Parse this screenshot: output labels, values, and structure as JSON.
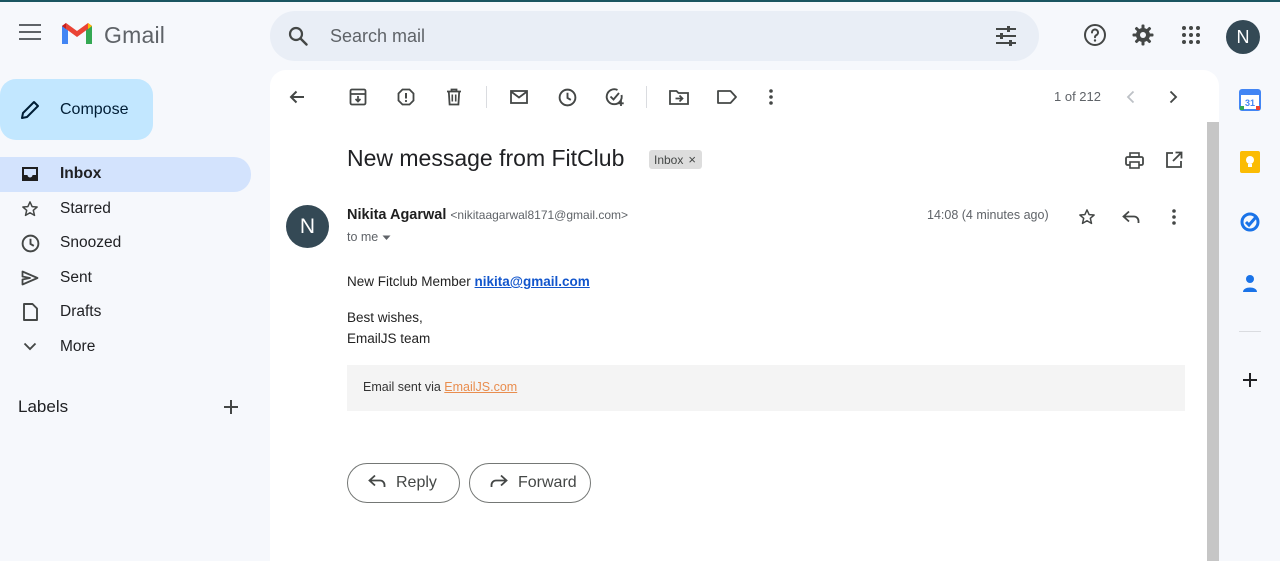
{
  "app": {
    "name": "Gmail"
  },
  "search": {
    "placeholder": "Search mail"
  },
  "header": {
    "account_initial": "N"
  },
  "nav": {
    "compose_label": "Compose",
    "items": [
      {
        "label": "Inbox",
        "icon": "inbox-icon",
        "active": true
      },
      {
        "label": "Starred",
        "icon": "star-icon"
      },
      {
        "label": "Snoozed",
        "icon": "clock-icon"
      },
      {
        "label": "Sent",
        "icon": "send-icon"
      },
      {
        "label": "Drafts",
        "icon": "draft-icon"
      },
      {
        "label": "More",
        "icon": "chevron-down-icon"
      }
    ],
    "labels_title": "Labels"
  },
  "message": {
    "pager": "1 of 212",
    "subject": "New message from FitClub",
    "badge": "Inbox",
    "sender_initial": "N",
    "sender_name": "Nikita Agarwal",
    "sender_email": "<nikitaagarwal8171@gmail.com>",
    "to": "to me",
    "time": "14:08 (4 minutes ago)",
    "body_line1_text": "New Fitclub Member ",
    "body_line1_link": "nikita@gmail.com",
    "body_line2": "Best wishes,",
    "body_line3": "EmailJS team",
    "footer_text": "Email sent via ",
    "footer_link": "EmailJS.com",
    "reply_label": "Reply",
    "forward_label": "Forward"
  },
  "rail": {
    "calendar_day": "31"
  },
  "colors": {
    "accent": "#c2e7ff",
    "active_nav": "#d3e3fd",
    "link": "#1155cc",
    "footer_link": "#e98d4e"
  }
}
